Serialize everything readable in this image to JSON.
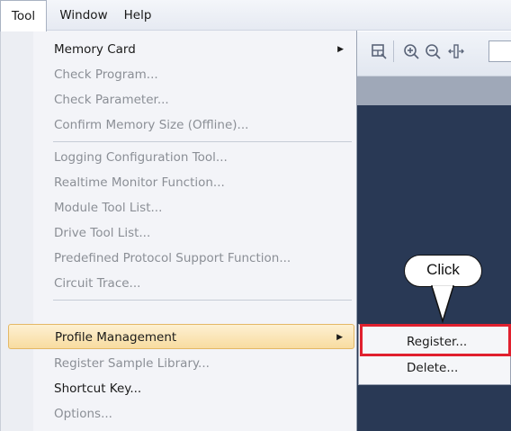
{
  "menubar": {
    "items": [
      {
        "label": "Tool",
        "active": true
      },
      {
        "label": "Window",
        "active": false
      },
      {
        "label": "Help",
        "active": false
      }
    ]
  },
  "toolbar": {
    "icons": [
      "layout-icon",
      "zoom-in-icon",
      "zoom-out-icon",
      "fit-icon"
    ]
  },
  "tool_menu": {
    "items": [
      {
        "label": "Memory Card",
        "enabled": true,
        "submenu": true
      },
      {
        "label": "Check Program...",
        "enabled": false
      },
      {
        "label": "Check Parameter...",
        "enabled": false
      },
      {
        "label": "Confirm Memory Size (Offline)...",
        "enabled": false
      },
      {
        "label": "Logging Configuration Tool...",
        "enabled": false
      },
      {
        "label": "Realtime Monitor Function...",
        "enabled": false
      },
      {
        "label": "Module Tool List...",
        "enabled": false
      },
      {
        "label": "Drive Tool List...",
        "enabled": false
      },
      {
        "label": "Predefined Protocol Support Function...",
        "enabled": false
      },
      {
        "label": "Circuit Trace...",
        "enabled": false
      },
      {
        "label": "Profile Management",
        "enabled": true,
        "submenu": true,
        "highlighted": true
      },
      {
        "label": "Register Sample Library...",
        "enabled": false
      },
      {
        "label": "Shortcut Key...",
        "enabled": true
      },
      {
        "label": "Options...",
        "enabled": false
      }
    ]
  },
  "submenu": {
    "items": [
      {
        "label": "Register..."
      },
      {
        "label": "Delete..."
      }
    ]
  },
  "callout": {
    "text": "Click"
  },
  "colors": {
    "highlight": "#f8dca0",
    "annotation_red": "#e0202e",
    "workarea": "#293955"
  }
}
